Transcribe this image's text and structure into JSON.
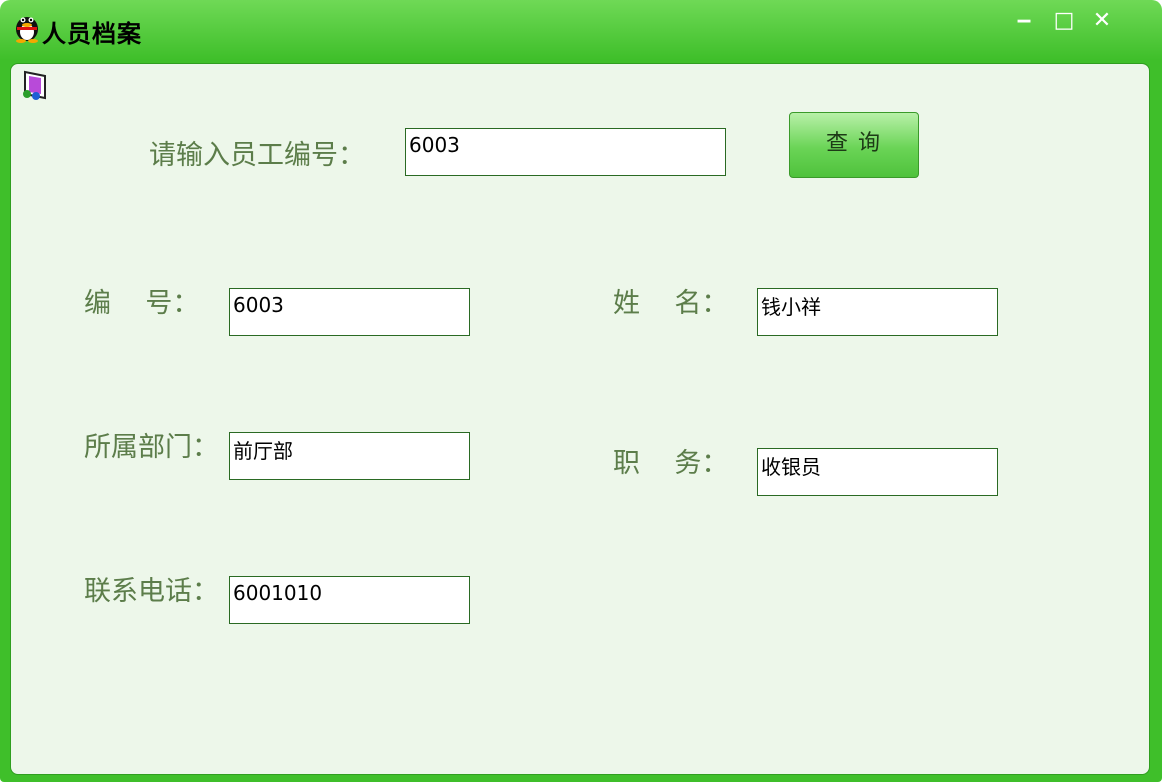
{
  "window": {
    "title": "人员档案",
    "controls": {
      "minimize": "‒",
      "maximize": "□",
      "close": "✕"
    }
  },
  "query": {
    "label": "请输入员工编号：",
    "value": "6003",
    "button_label": "查询"
  },
  "fields": {
    "id": {
      "label": "编    号：",
      "value": "6003"
    },
    "name": {
      "label": "姓    名：",
      "value": "钱小祥"
    },
    "department": {
      "label": "所属部门：",
      "value": "前厅部"
    },
    "position": {
      "label": "职    务：",
      "value": "收银员"
    },
    "phone": {
      "label": "联系电话：",
      "value": "6001010"
    }
  },
  "icons": {
    "app": "penguin-icon",
    "form": "form-tool-icon"
  },
  "colors": {
    "frame": "#3fbf2a",
    "client": "#edf7ea",
    "label": "#5c7d4a"
  }
}
